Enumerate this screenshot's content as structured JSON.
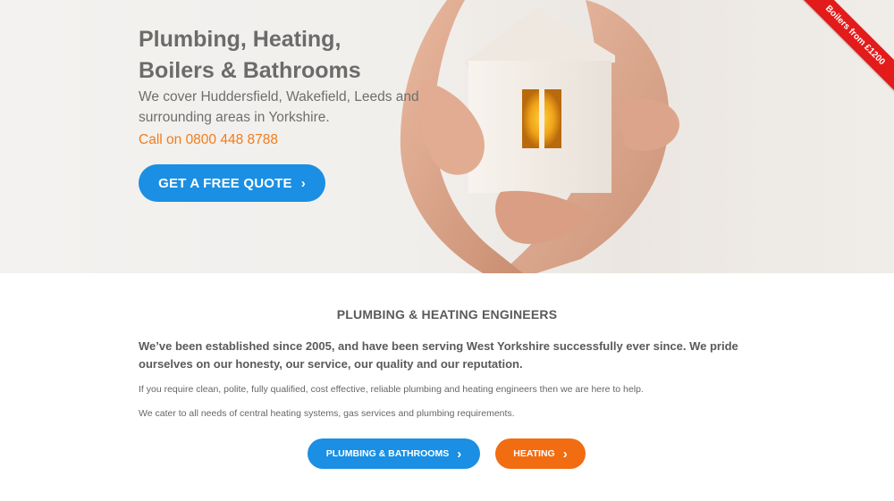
{
  "hero": {
    "title_line1": "Plumbing, Heating,",
    "title_line2": "Boilers & Bathrooms",
    "subtitle": "We cover Huddersfield, Wakefield, Leeds and surrounding areas in Yorkshire.",
    "call_prefix": "Call on",
    "phone": "0800 448 8788",
    "quote_button": "GET A FREE QUOTE",
    "ribbon": "Boilers from £1200",
    "image_icon": "hands-holding-house-image"
  },
  "section": {
    "title": "PLUMBING & HEATING ENGINEERS",
    "intro": "We’ve been established since 2005, and have been serving West Yorkshire successfully ever since. We pride ourselves on our honesty, our service, our quality and our reputation.",
    "paragraph1": "If you require clean, polite, fully qualified, cost effective, reliable plumbing and heating engineers then we are here to help.",
    "paragraph2": "We cater to all needs of central heating systems, gas services and plumbing requirements.",
    "button_plumbing": "PLUMBING & BATHROOMS",
    "button_heating": "HEATING"
  },
  "colors": {
    "blue": "#1a8fe3",
    "orange": "#f26c12",
    "ribbon_red": "#e31b1b",
    "text_grey": "#6b6b6b"
  }
}
